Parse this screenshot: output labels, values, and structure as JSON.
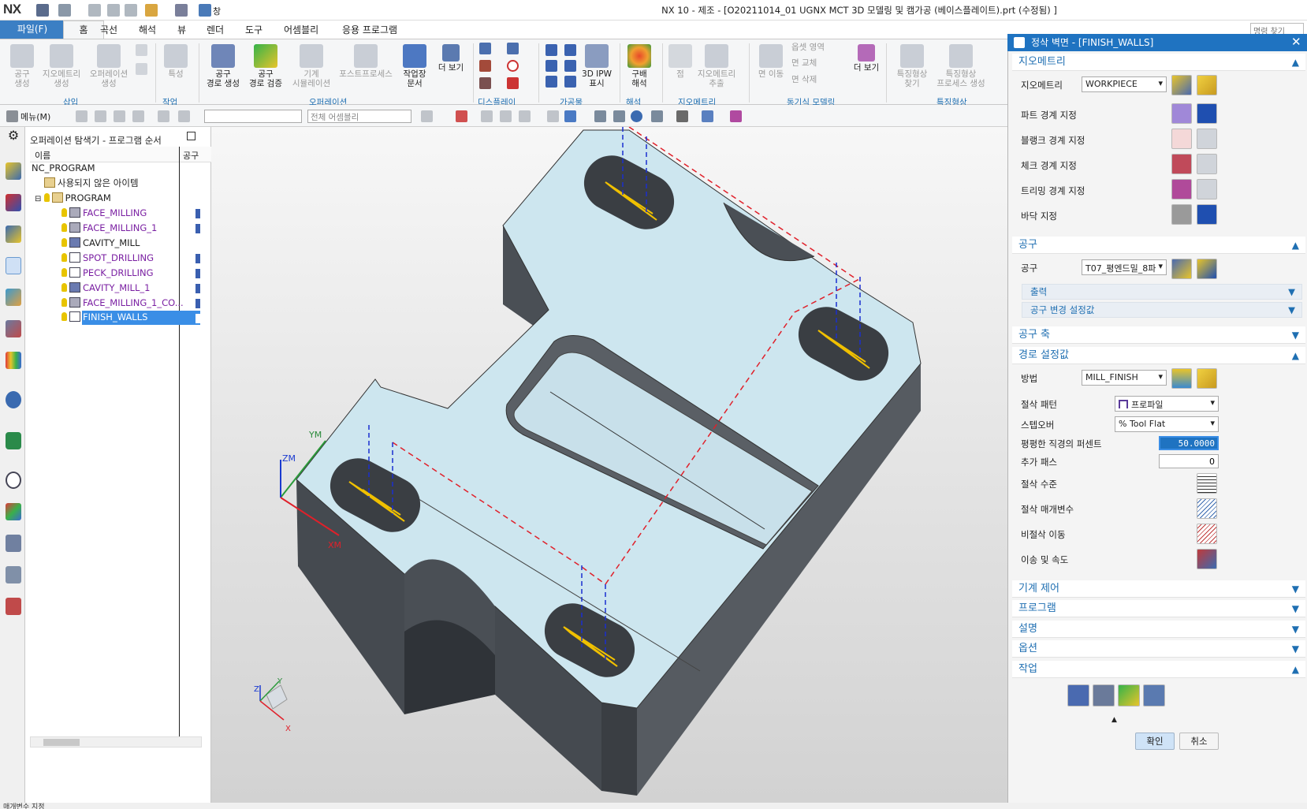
{
  "window": {
    "title": "NX 10 - 제조 - [O20211014_01 UGNX MCT 3D 모델링 및 캠가공 (베이스플레이트).prt (수정됨) ]",
    "logo": "NX",
    "window_menu": "창"
  },
  "menu": {
    "file": "파일(F)",
    "tabs": [
      "홈",
      "곡선",
      "해석",
      "뷰",
      "렌더",
      "도구",
      "어셈블리",
      "응용 프로그램"
    ],
    "search_placeholder": "명령 찾기"
  },
  "ribbon": {
    "buttons": [
      "공구\n생성",
      "지오메트리\n생성",
      "오퍼레이션\n생성",
      "특성",
      "공구\n경로 생성",
      "공구\n경로 검증",
      "기계\n시뮬레이션",
      "포스트프로세스",
      "작업장\n문서",
      "더 보기",
      "3D IPW\n표시",
      "구배\n해석",
      "점",
      "지오메트리\n추출",
      "면 이동",
      "더 보기",
      "특징형상\n찾기",
      "특징형상\n프로세스 생성"
    ],
    "small": [
      "옵셋 영역",
      "면 교체",
      "면 삭제"
    ],
    "groups": [
      "삽입",
      "작업",
      "오퍼레이션",
      "디스플레이",
      "가공물",
      "해석",
      "지오메트리",
      "동기식 모델링",
      "특징형상"
    ]
  },
  "toolbar2": {
    "menu": "메뉴(M)",
    "filter_placeholder": "",
    "assembly": "전체 어셈블리"
  },
  "navigator": {
    "title": "오퍼레이션 탐색기 - 프로그램 순서",
    "col_name": "이름",
    "col_tool": "공구",
    "rows": [
      {
        "label": "NC_PROGRAM"
      },
      {
        "label": "사용되지 않은 아이템"
      },
      {
        "label": "PROGRAM"
      },
      {
        "label": "FACE_MILLING"
      },
      {
        "label": "FACE_MILLING_1"
      },
      {
        "label": "CAVITY_MILL"
      },
      {
        "label": "SPOT_DRILLING"
      },
      {
        "label": "PECK_DRILLING"
      },
      {
        "label": "CAVITY_MILL_1"
      },
      {
        "label": "FACE_MILLING_1_CO..."
      },
      {
        "label": "FINISH_WALLS"
      }
    ]
  },
  "viewport": {
    "axes": {
      "xm": "XM",
      "ym": "YM",
      "zm": "ZM",
      "x": "X",
      "y": "Y",
      "z": "Z"
    }
  },
  "panel": {
    "title": "정삭 벽면 - [FINISH_WALLS]",
    "sections": {
      "geometry": "지오메트리",
      "tool": "공구",
      "tool_axis": "공구 축",
      "path": "경로 설정값",
      "machine": "기계 제어",
      "program": "프로그램",
      "desc": "설명",
      "options": "옵션",
      "actions": "작업"
    },
    "geometry": {
      "label": "지오메트리",
      "value": "WORKPIECE",
      "part": "파트 경계 지정",
      "blank": "블랭크 경계 지정",
      "check": "체크 경계 지정",
      "trim": "트리밍 경계 지정",
      "floor": "바닥 지정"
    },
    "tool": {
      "label": "공구",
      "value": "T07_평엔드밀_8파",
      "output": "출력",
      "change": "공구 변경 설정값"
    },
    "path": {
      "method_label": "방법",
      "method": "MILL_FINISH",
      "pattern_label": "절삭 패턴",
      "pattern": "프로파일",
      "stepover_label": "스텝오버",
      "stepover": "% Tool Flat",
      "percent_label": "평평한 직경의 퍼센트",
      "percent": "50.0000",
      "extra_label": "추가 패스",
      "extra": "0",
      "levels": "절삭 수준",
      "params": "절삭 매개변수",
      "noncut": "비절삭 이동",
      "feeds": "이송 및 속도"
    },
    "ok": "확인",
    "cancel": "취소"
  },
  "status": "매개변수 지정",
  "colors": {
    "accent": "#1f73c1",
    "section": "#1f6fb2",
    "toolpath": "#f0c000",
    "rapid": "#e0202a",
    "feed": "#1a2fd0"
  }
}
